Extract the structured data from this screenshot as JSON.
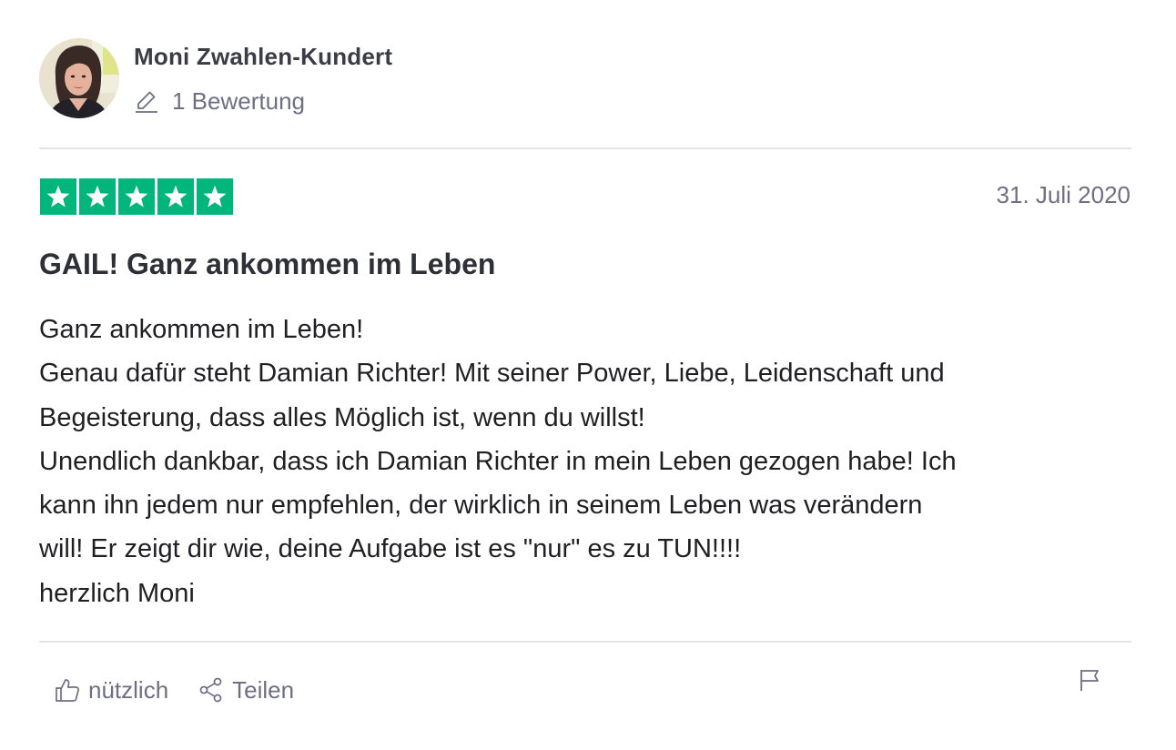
{
  "consumer": {
    "name": "Moni Zwahlen-Kundert",
    "review_count": "1 Bewertung",
    "avatar_icon": "profile-photo"
  },
  "review": {
    "rating": 5,
    "rating_max": 5,
    "star_color": "#00b67a",
    "date": "31. Juli 2020",
    "title": "GAIL! Ganz ankommen im Leben",
    "body_lines": [
      "Ganz ankommen im Leben!",
      "Genau dafür steht Damian Richter! Mit seiner Power, Liebe, Leidenschaft und",
      "Begeisterung, dass alles Möglich ist, wenn du willst!",
      "Unendlich dankbar, dass ich Damian Richter in mein Leben gezogen habe! Ich",
      "kann ihn jedem nur empfehlen, der wirklich in seinem Leben was verändern",
      "will! Er zeigt dir wie, deine Aufgabe ist es \"nur\" es zu TUN!!!!",
      "herzlich Moni"
    ]
  },
  "actions": {
    "useful_label": "nützlich",
    "useful_icon": "thumbs-up-icon",
    "share_label": "Teilen",
    "share_icon": "share-icon",
    "report_icon": "flag-icon"
  }
}
